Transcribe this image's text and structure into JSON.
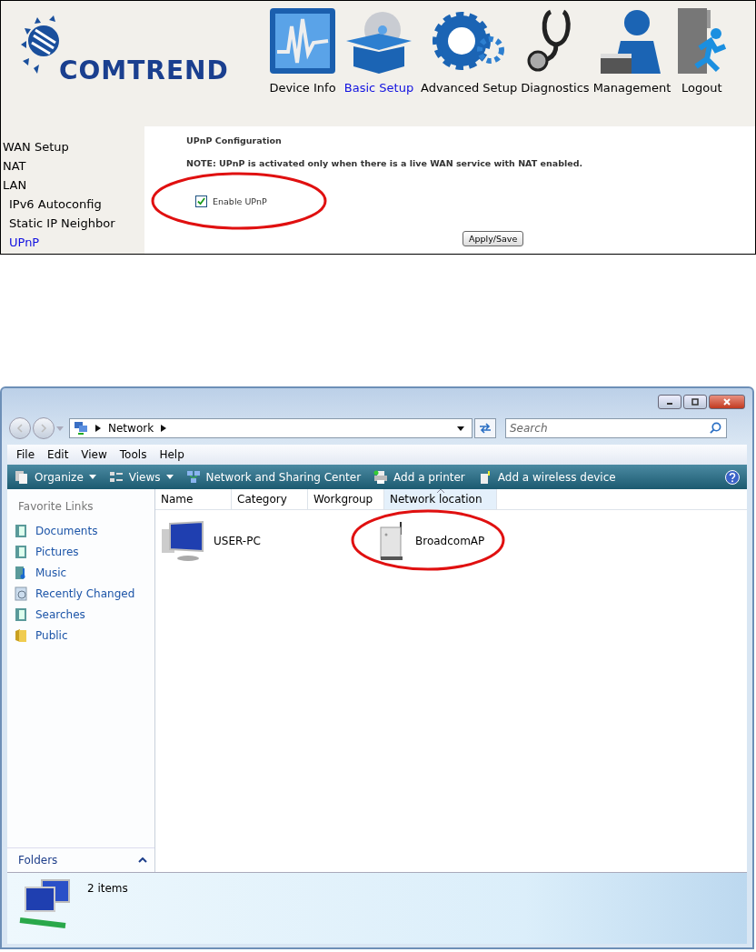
{
  "router": {
    "logo": "COMTREND",
    "nav": [
      {
        "label": "Device Info",
        "kind": "chart",
        "selected": false
      },
      {
        "label": "Basic Setup",
        "kind": "box",
        "selected": true
      },
      {
        "label": "Advanced Setup",
        "kind": "gear",
        "selected": false
      },
      {
        "label": "Diagnostics",
        "kind": "stethoscope",
        "selected": false
      },
      {
        "label": "Management",
        "kind": "person",
        "selected": false
      },
      {
        "label": "Logout",
        "kind": "exit",
        "selected": false
      }
    ],
    "sidebar": [
      {
        "label": "WAN Setup",
        "selected": false
      },
      {
        "label": "NAT",
        "selected": false
      },
      {
        "label": "LAN",
        "selected": false,
        "children": [
          {
            "label": "IPv6 Autoconfig",
            "selected": false
          },
          {
            "label": "Static IP Neighbor",
            "selected": false
          },
          {
            "label": "UPnP",
            "selected": true
          }
        ]
      }
    ],
    "title": "UPnP Configuration",
    "note": "NOTE: UPnP is activated only when there is a live WAN service with NAT enabled.",
    "checkbox": {
      "label": "Enable UPnP",
      "checked": true,
      "circled": true
    },
    "button": "Apply/Save"
  },
  "explorer": {
    "address": [
      "Network"
    ],
    "search": {
      "placeholder": "Search"
    },
    "menu": [
      "File",
      "Edit",
      "View",
      "Tools",
      "Help"
    ],
    "toolbar": [
      {
        "label": "Organize",
        "kind": "pages",
        "dropdown": true
      },
      {
        "label": "Views",
        "kind": "views",
        "dropdown": true
      },
      {
        "label": "Network and Sharing Center",
        "kind": "network",
        "dropdown": false
      },
      {
        "label": "Add a printer",
        "kind": "printer",
        "dropdown": false
      },
      {
        "label": "Add a wireless device",
        "kind": "wireless",
        "dropdown": false
      }
    ],
    "favorites_title": "Favorite Links",
    "favorites": [
      {
        "label": "Documents",
        "kind": "doc"
      },
      {
        "label": "Pictures",
        "kind": "doc"
      },
      {
        "label": "Music",
        "kind": "music"
      },
      {
        "label": "Recently Changed",
        "kind": "recent"
      },
      {
        "label": "Searches",
        "kind": "doc"
      },
      {
        "label": "Public",
        "kind": "folder"
      }
    ],
    "columns": [
      {
        "label": "Name",
        "sorted": false
      },
      {
        "label": "Category",
        "sorted": false
      },
      {
        "label": "Workgroup",
        "sorted": false
      },
      {
        "label": "Network location",
        "sorted": true
      }
    ],
    "items": [
      {
        "name": "USER-PC",
        "kind": "computer",
        "circled": false
      },
      {
        "name": "BroadcomAP",
        "kind": "router",
        "circled": true
      }
    ],
    "folders": "Folders",
    "status": "2 items"
  }
}
